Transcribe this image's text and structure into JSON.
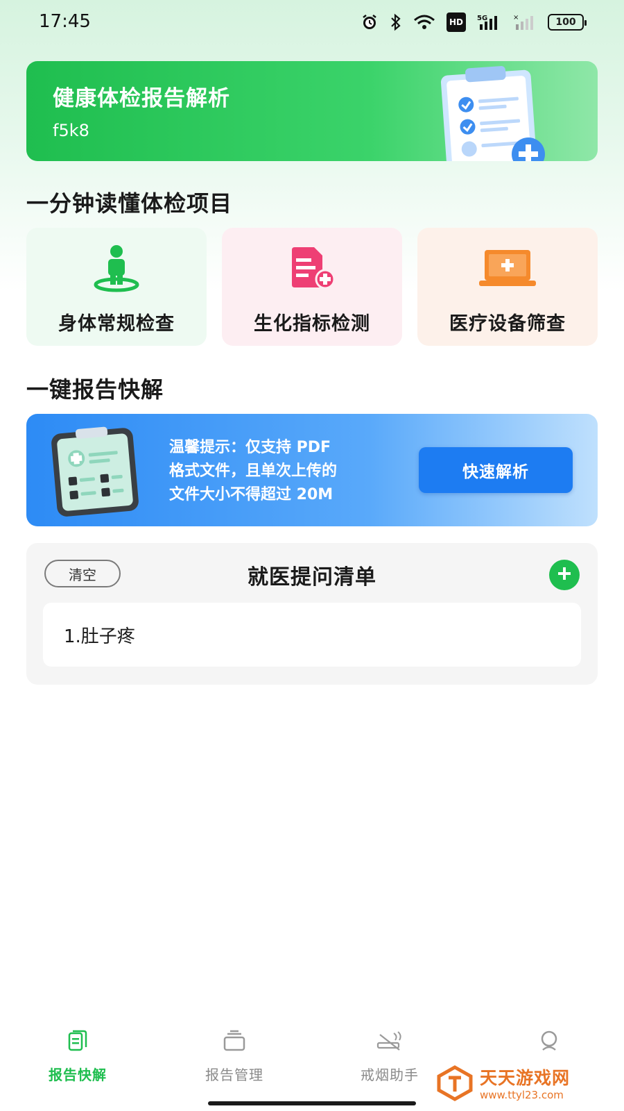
{
  "status_bar": {
    "time": "17:45",
    "hd_label": "HD",
    "network_label": "5G",
    "battery": "100"
  },
  "hero": {
    "title": "健康体检报告解析",
    "subtitle": "f5k8"
  },
  "section_one_minute": {
    "title": "一分钟读懂体检项目"
  },
  "categories": [
    {
      "label": "身体常规检查",
      "icon": "person-location-icon",
      "color": "#1fbe4f"
    },
    {
      "label": "生化指标检测",
      "icon": "medical-document-plus-icon",
      "color": "#ee3f74"
    },
    {
      "label": "医疗设备筛查",
      "icon": "medical-laptop-icon",
      "color": "#f58a2c"
    }
  ],
  "section_quick": {
    "title": "一键报告快解"
  },
  "upload": {
    "tip_lines": [
      "温馨提示：仅支持 PDF",
      "格式文件，且单次上传的",
      "文件大小不得超过 20M"
    ],
    "button_label": "快速解析"
  },
  "question_list": {
    "clear_label": "清空",
    "title": "就医提问清单",
    "items": [
      "1.肚子疼"
    ]
  },
  "bottom_nav": {
    "items": [
      {
        "label": "报告快解",
        "icon": "report-quick-icon",
        "active": true
      },
      {
        "label": "报告管理",
        "icon": "report-manage-icon",
        "active": false
      },
      {
        "label": "戒烟助手",
        "icon": "no-smoking-icon",
        "active": false
      },
      {
        "label": "",
        "icon": "profile-icon",
        "active": false
      }
    ]
  },
  "watermark": {
    "title": "天天游戏网",
    "url": "www.ttyl23.com"
  },
  "colors": {
    "brand_green": "#1fbe4f",
    "brand_blue": "#1d7cf2"
  }
}
